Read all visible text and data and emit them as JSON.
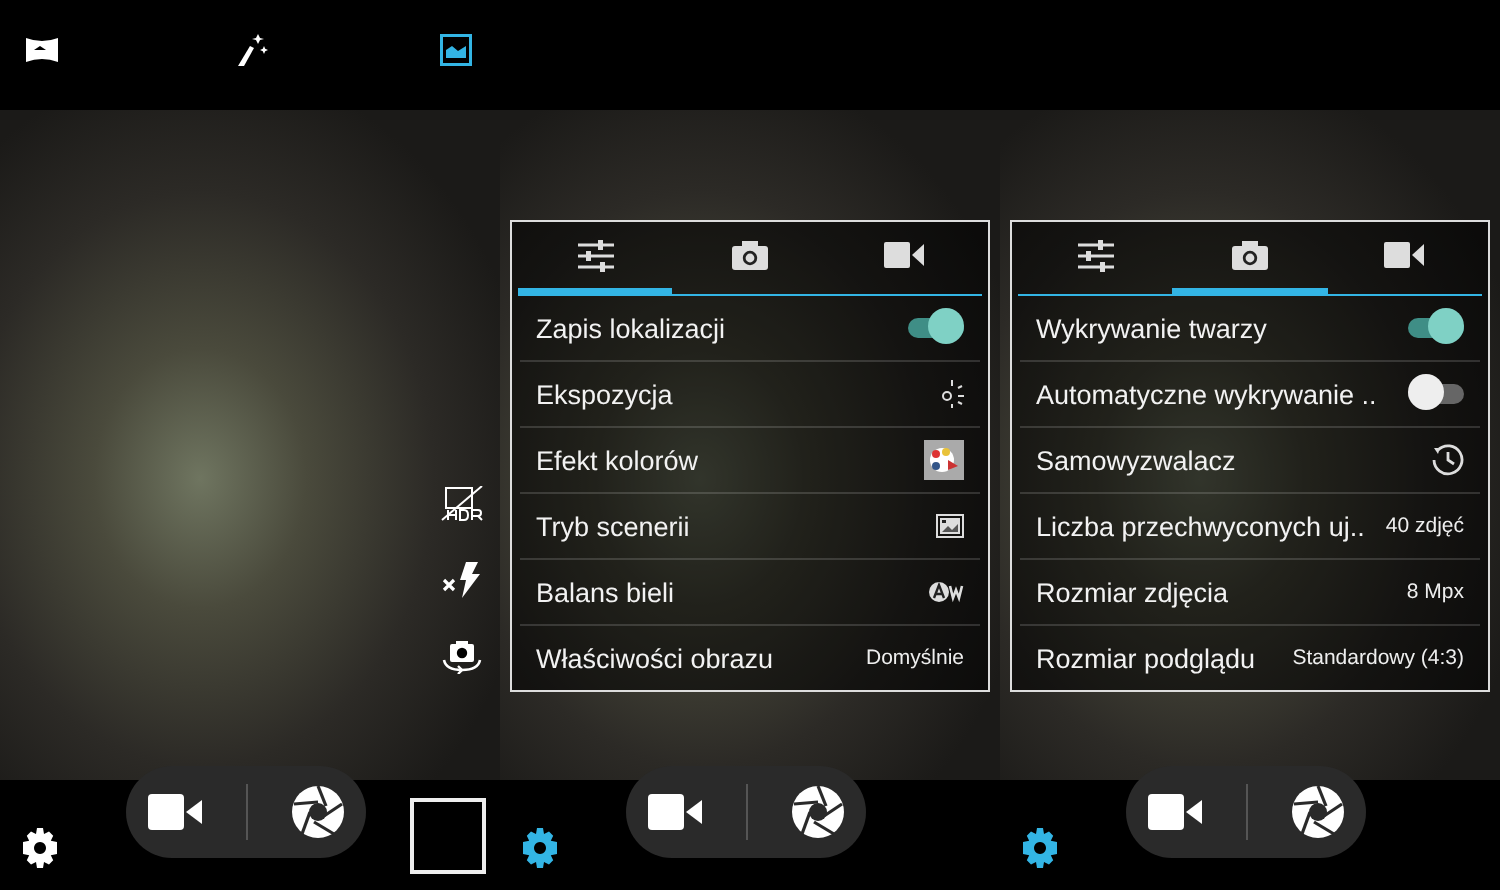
{
  "top_bar": {
    "modes": [
      {
        "kind": "panorama",
        "selected": false
      },
      {
        "kind": "effects",
        "selected": false
      },
      {
        "kind": "photo",
        "selected": true
      }
    ]
  },
  "panels": [
    {
      "settings_open": false,
      "thumbnail": true,
      "side_icons": [
        {
          "kind": "hdr-off"
        },
        {
          "kind": "flash-off"
        },
        {
          "kind": "switch-camera"
        }
      ]
    },
    {
      "settings_open": true,
      "thumbnail": false,
      "menu": {
        "tabs": [
          {
            "kind": "settings",
            "selected": true
          },
          {
            "kind": "photo",
            "selected": false
          },
          {
            "kind": "video",
            "selected": false
          }
        ],
        "rows": [
          {
            "kind": "toggle",
            "label": "Zapis lokalizacji",
            "on": true
          },
          {
            "kind": "exposure",
            "label": "Ekspozycja"
          },
          {
            "kind": "color-effect",
            "label": "Efekt kolorów"
          },
          {
            "kind": "scene",
            "label": "Tryb scenerii"
          },
          {
            "kind": "white-balance",
            "label": "Balans bieli"
          },
          {
            "kind": "value",
            "label": "Właściwości obrazu",
            "value": "Domyślnie"
          }
        ]
      }
    },
    {
      "settings_open": true,
      "thumbnail": false,
      "menu": {
        "tabs": [
          {
            "kind": "settings",
            "selected": false
          },
          {
            "kind": "photo",
            "selected": true
          },
          {
            "kind": "video",
            "selected": false
          }
        ],
        "rows": [
          {
            "kind": "toggle",
            "label": "Wykrywanie twarzy",
            "on": true
          },
          {
            "kind": "toggle",
            "label": "Automatyczne wykrywanie ..",
            "on": false
          },
          {
            "kind": "timer",
            "label": "Samowyzwalacz"
          },
          {
            "kind": "value",
            "label": "Liczba przechwyconych uj..",
            "value": "40 zdjęć"
          },
          {
            "kind": "value",
            "label": "Rozmiar zdjęcia",
            "value": "8 Mpx"
          },
          {
            "kind": "value",
            "label": "Rozmiar podglądu",
            "value": "Standardowy (4:3)"
          }
        ]
      }
    }
  ]
}
